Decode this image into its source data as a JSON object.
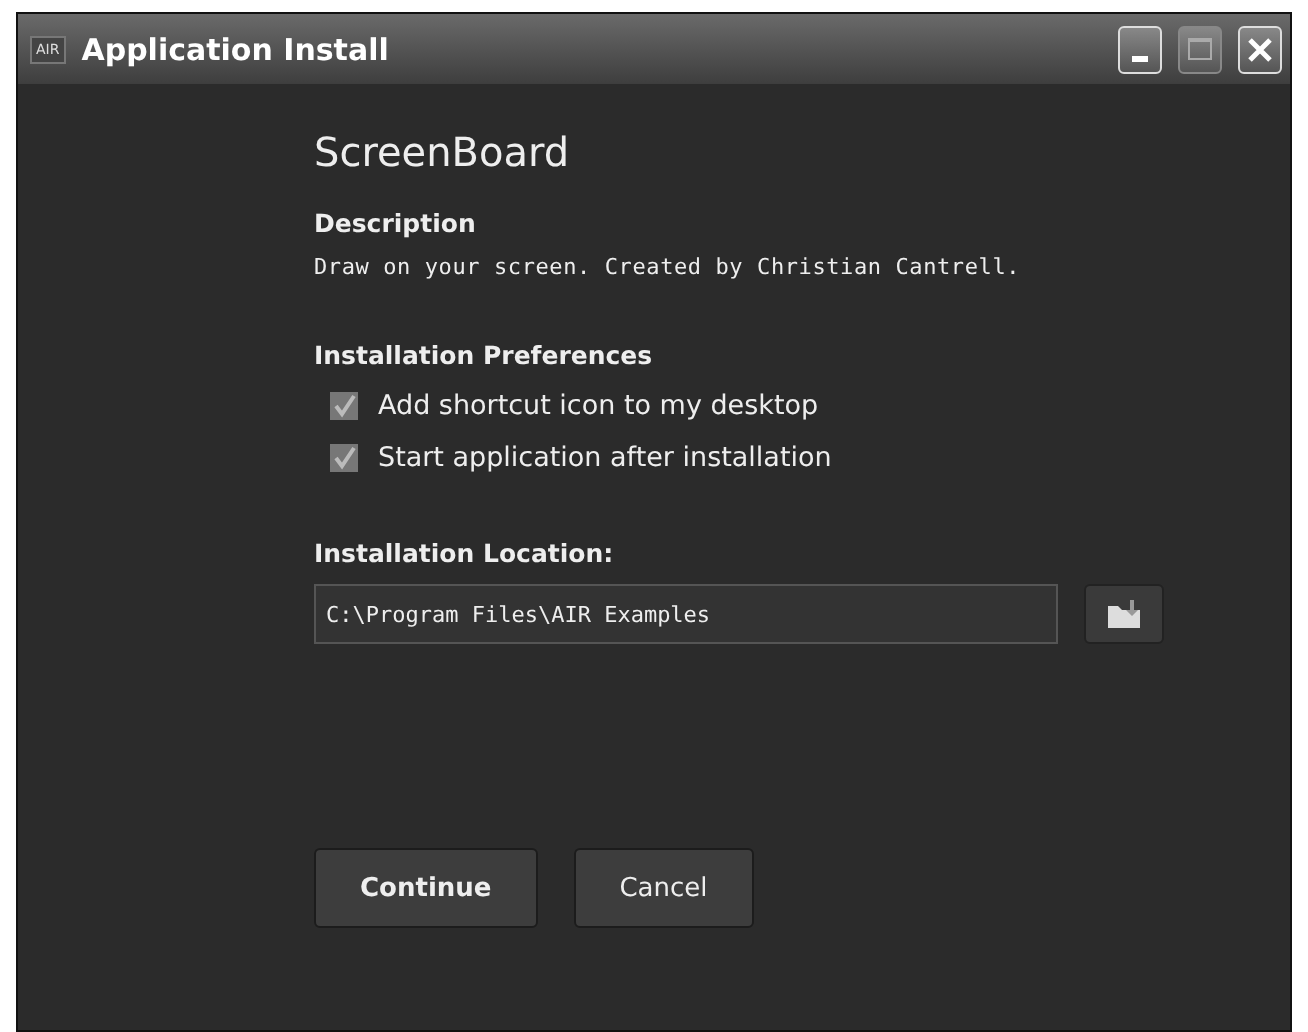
{
  "window": {
    "title": "Application Install",
    "badge": "AIR"
  },
  "app_name": "ScreenBoard",
  "description": {
    "heading": "Description",
    "text": "Draw on your screen. Created by Christian Cantrell."
  },
  "preferences": {
    "heading": "Installation Preferences",
    "options": [
      {
        "label": "Add shortcut icon to my desktop",
        "checked": true
      },
      {
        "label": "Start application after installation",
        "checked": true
      }
    ]
  },
  "location": {
    "heading": "Installation Location:",
    "value": "C:\\Program Files\\AIR Examples"
  },
  "buttons": [
    "Continue",
    "Cancel"
  ]
}
